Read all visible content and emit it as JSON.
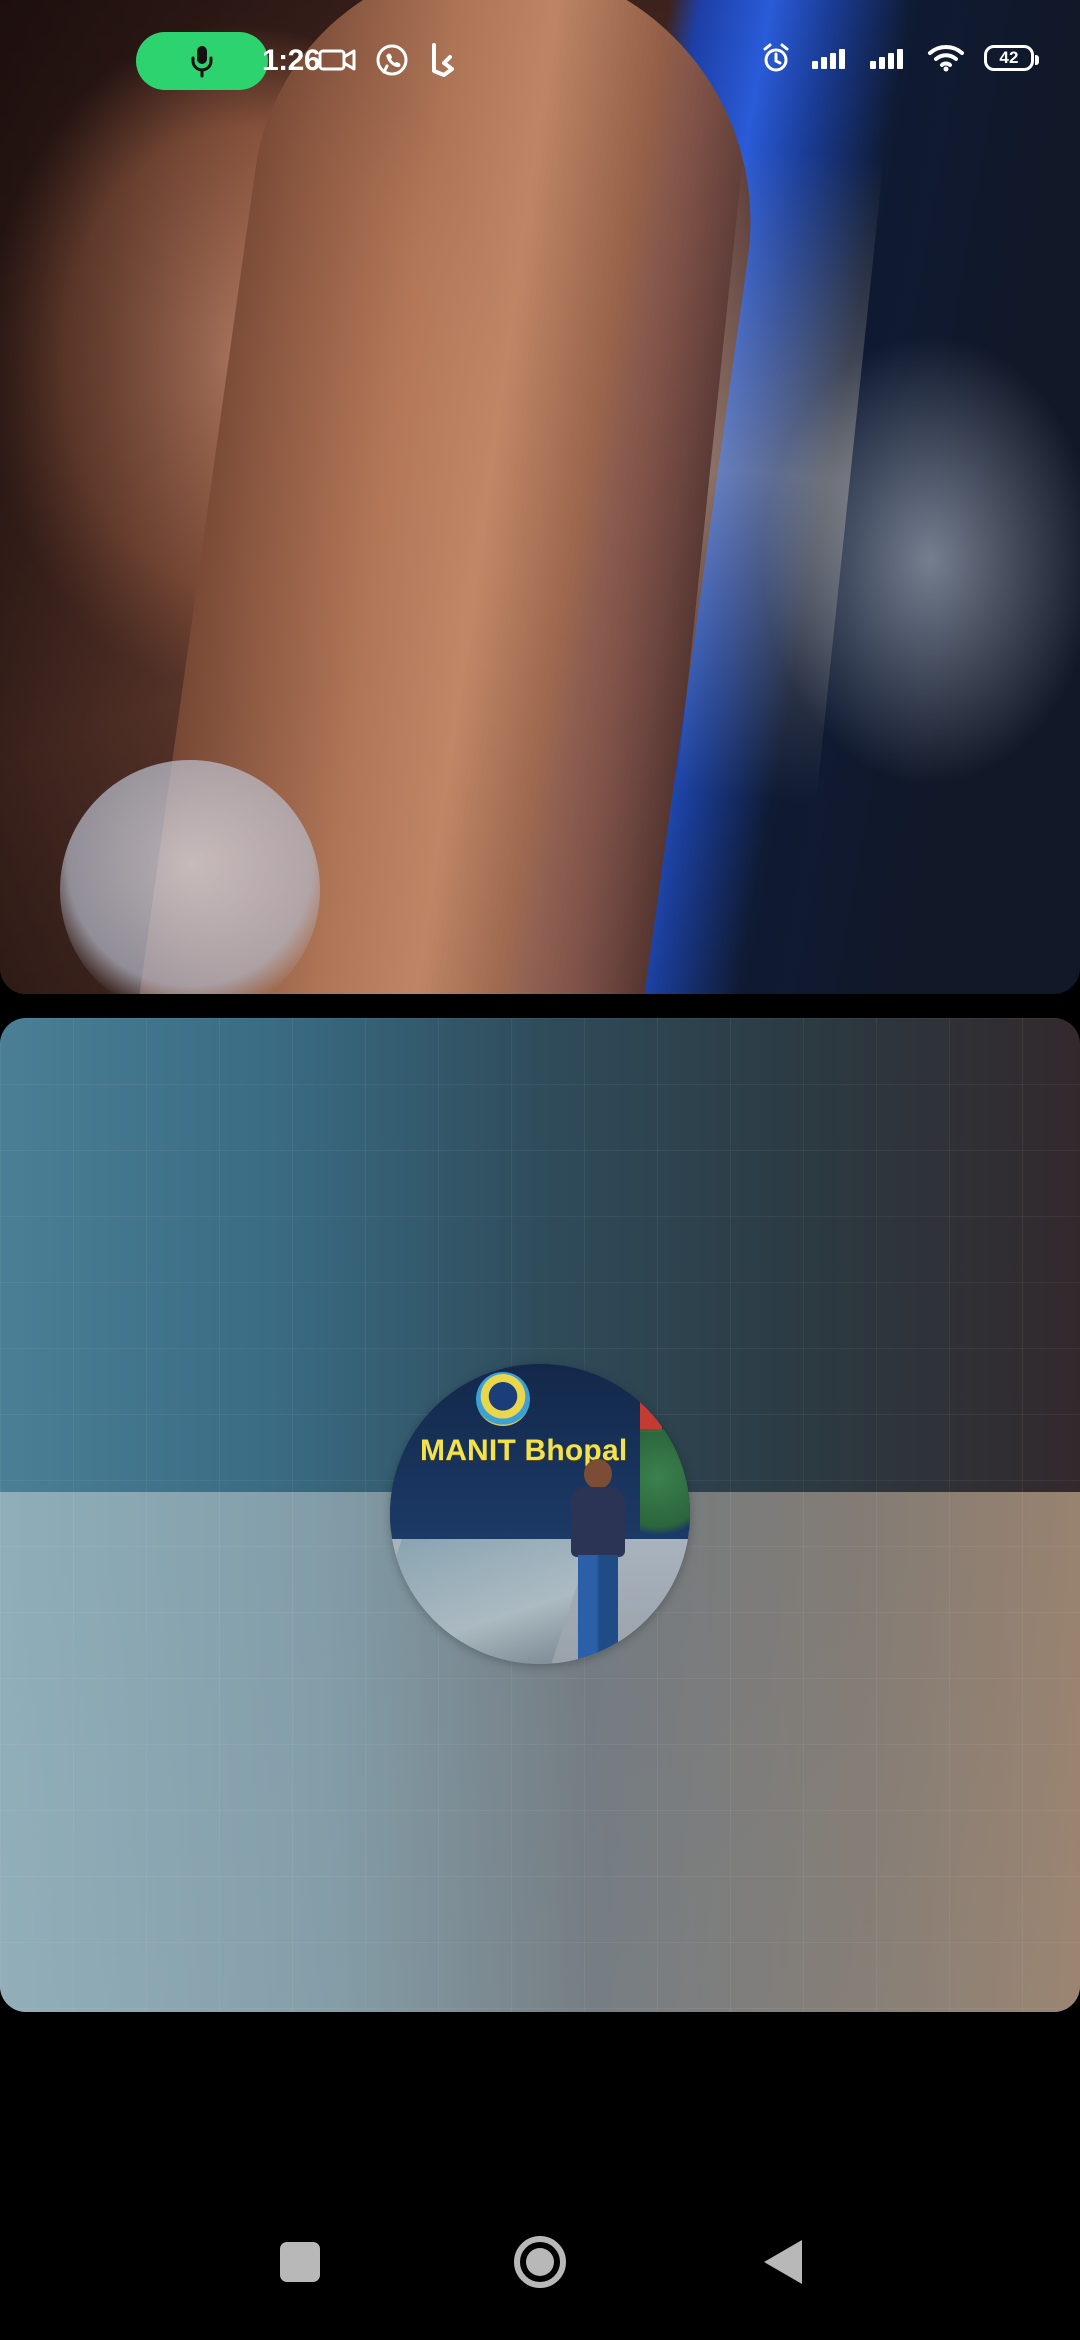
{
  "status_bar": {
    "time": "1:26",
    "battery_level": "42",
    "mic_indicator_color": "#2dd36f",
    "left_icons": [
      "microphone-icon",
      "video-camera-icon",
      "whatsapp-icon",
      "bing-icon"
    ],
    "right_icons": [
      "alarm-icon",
      "signal-bars-icon",
      "signal-bars-icon",
      "wifi-icon",
      "battery-icon"
    ]
  },
  "call": {
    "remote_video": "video-feed",
    "local_video": {
      "avatar_text": "MANIT Bhopal"
    }
  },
  "nav_bar": {
    "buttons": [
      "recent-apps-button",
      "home-button",
      "back-button"
    ],
    "button_color": "#b8b8b8"
  }
}
